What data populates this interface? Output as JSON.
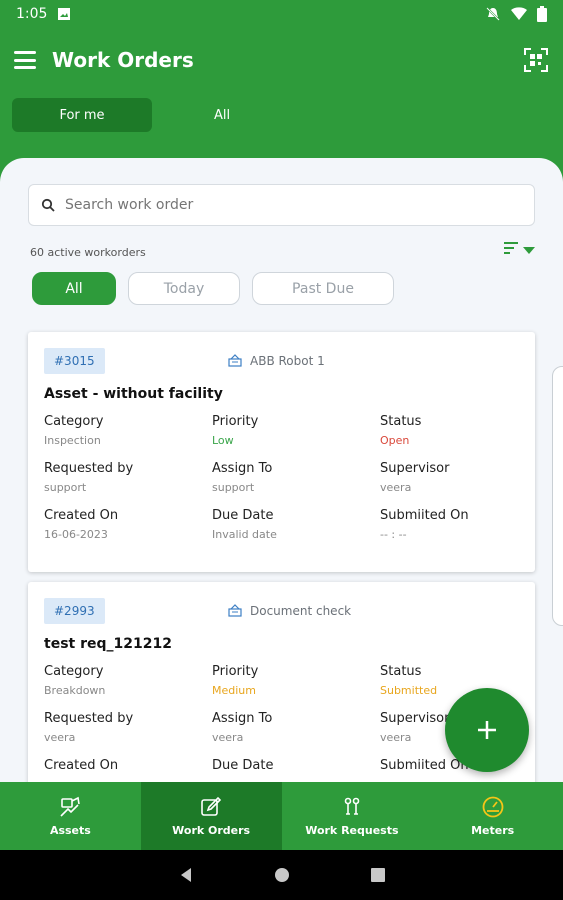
{
  "status_bar": {
    "time": "1:05"
  },
  "header": {
    "title": "Work Orders"
  },
  "toggle": [
    {
      "label": "For me"
    },
    {
      "label": "All"
    }
  ],
  "search": {
    "placeholder": "Search work order"
  },
  "summary": {
    "count_text": "60 active workorders"
  },
  "filters": [
    {
      "label": "All"
    },
    {
      "label": "Today"
    },
    {
      "label": "Past Due"
    }
  ],
  "work_orders": [
    {
      "id": "#3015",
      "asset": "ABB Robot 1",
      "title": "Asset - without facility",
      "fields": [
        {
          "label": "Category",
          "value": "Inspection"
        },
        {
          "label": "Priority",
          "value": "Low"
        },
        {
          "label": "Status",
          "value": "Open"
        },
        {
          "label": "Requested by",
          "value": "support"
        },
        {
          "label": "Assign To",
          "value": "support"
        },
        {
          "label": "Supervisor",
          "value": "veera"
        },
        {
          "label": "Created On",
          "value": "16-06-2023"
        },
        {
          "label": "Due Date",
          "value": "Invalid date"
        },
        {
          "label": "Submiited On",
          "value": "-- : --"
        }
      ]
    },
    {
      "id": "#2993",
      "asset": "Document check",
      "title": "test req_121212",
      "fields": [
        {
          "label": "Category",
          "value": "Breakdown"
        },
        {
          "label": "Priority",
          "value": "Medium"
        },
        {
          "label": "Status",
          "value": "Submitted"
        },
        {
          "label": "Requested by",
          "value": "veera"
        },
        {
          "label": "Assign To",
          "value": "veera"
        },
        {
          "label": "Supervisor",
          "value": "veera"
        },
        {
          "label": "Created On",
          "value": ""
        },
        {
          "label": "Due Date",
          "value": ""
        },
        {
          "label": "Submiited On",
          "value": ""
        }
      ]
    }
  ],
  "bottom_nav": [
    {
      "label": "Assets",
      "icon": "assets-icon"
    },
    {
      "label": "Work Orders",
      "icon": "work-orders-icon"
    },
    {
      "label": "Work Requests",
      "icon": "work-requests-icon"
    },
    {
      "label": "Meters",
      "icon": "meters-icon"
    }
  ],
  "colors": {
    "brand": "#2e9b3b",
    "brand_dark": "#1d7a28",
    "priority_low": "#3aa54a",
    "status_open": "#d9483b",
    "priority_medium": "#e8a61e",
    "id_badge": "#dbe9f8"
  }
}
